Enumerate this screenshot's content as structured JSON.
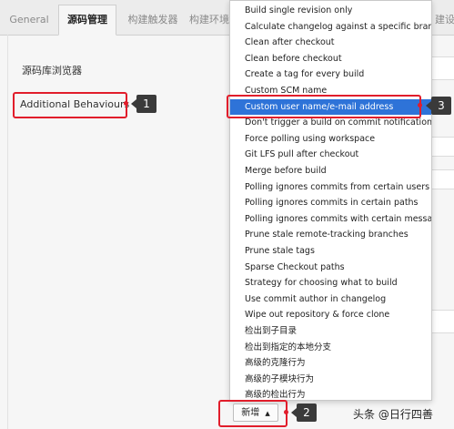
{
  "tabs": [
    {
      "label": "General",
      "active": false
    },
    {
      "label": "源码管理",
      "active": true
    },
    {
      "label": "构建触发器",
      "active": false
    },
    {
      "label": "构建环境",
      "active": false
    },
    {
      "label": "建设",
      "active": false
    }
  ],
  "form": {
    "repo_browser_label": "源码库浏览器",
    "additional_behaviours_label": "Additional Behaviours"
  },
  "menu": {
    "items": [
      "Build single revision only",
      "Calculate changelog against a specific branch",
      "Clean after checkout",
      "Clean before checkout",
      "Create a tag for every build",
      "Custom SCM name",
      "Custom user name/e-mail address",
      "Don't trigger a build on commit notifications",
      "Force polling using workspace",
      "Git LFS pull after checkout",
      "Merge before build",
      "Polling ignores commits from certain users",
      "Polling ignores commits in certain paths",
      "Polling ignores commits with certain messages",
      "Prune stale remote-tracking branches",
      "Prune stale tags",
      "Sparse Checkout paths",
      "Strategy for choosing what to build",
      "Use commit author in changelog",
      "Wipe out repository & force clone",
      "检出到子目录",
      "检出到指定的本地分支",
      "高级的克隆行为",
      "高级的子模块行为",
      "高级的检出行为"
    ],
    "highlighted_index": 6
  },
  "add_button": {
    "label": "新增",
    "caret": "▲"
  },
  "callouts": {
    "one": "1",
    "two": "2",
    "three": "3"
  },
  "watermark": "头条 @日行四善",
  "colors": {
    "accent_red": "#e11d2b",
    "highlight_blue": "#2e73d8",
    "badge_dark": "#3a3a3a"
  }
}
